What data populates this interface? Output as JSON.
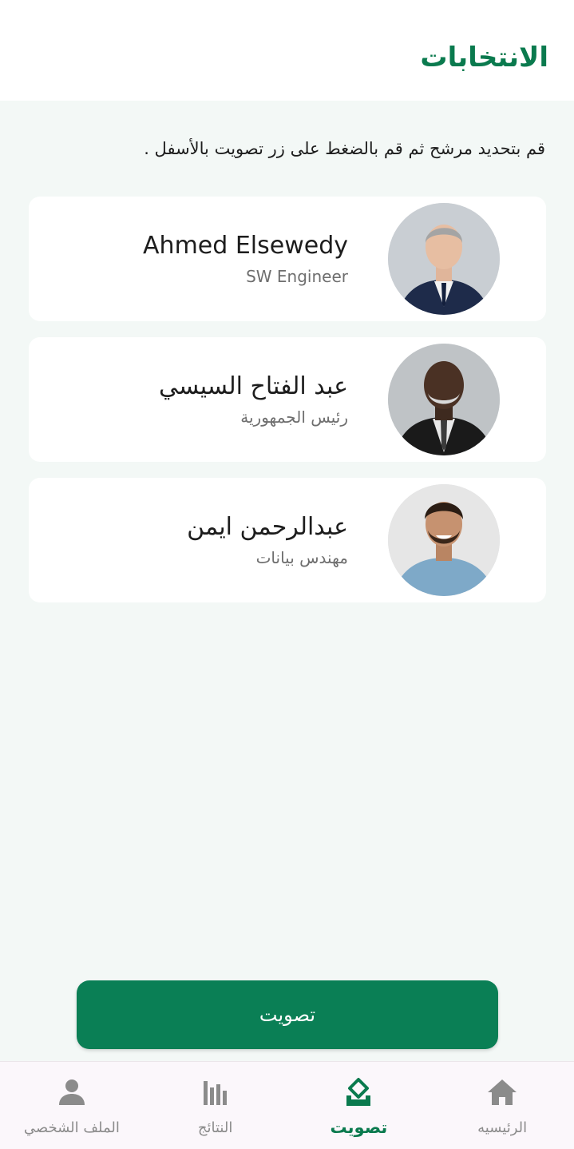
{
  "header": {
    "title": "الانتخابات"
  },
  "instructions": "قم بتحديد مرشح ثم قم بالضغط على زر تصويت بالأسفل .",
  "candidates": [
    {
      "name": "Ahmed Elsewedy",
      "title": "SW Engineer"
    },
    {
      "name": "عبد الفتاح السيسي",
      "title": "رئيس الجمهورية"
    },
    {
      "name": "عبدالرحمن ايمن",
      "title": "مهندس بيانات"
    }
  ],
  "vote_button": {
    "label": "تصويت"
  },
  "nav": {
    "home": {
      "label": "الرئيسيه",
      "icon": "home-icon"
    },
    "vote": {
      "label": "تصويت",
      "icon": "ballot-icon"
    },
    "results": {
      "label": "النتائج",
      "icon": "bar-chart-icon"
    },
    "profile": {
      "label": "الملف الشخصي",
      "icon": "person-icon"
    }
  },
  "colors": {
    "primary": "#0a7a4e",
    "background": "#f3f8f6",
    "inactive": "#8b8b8b"
  }
}
